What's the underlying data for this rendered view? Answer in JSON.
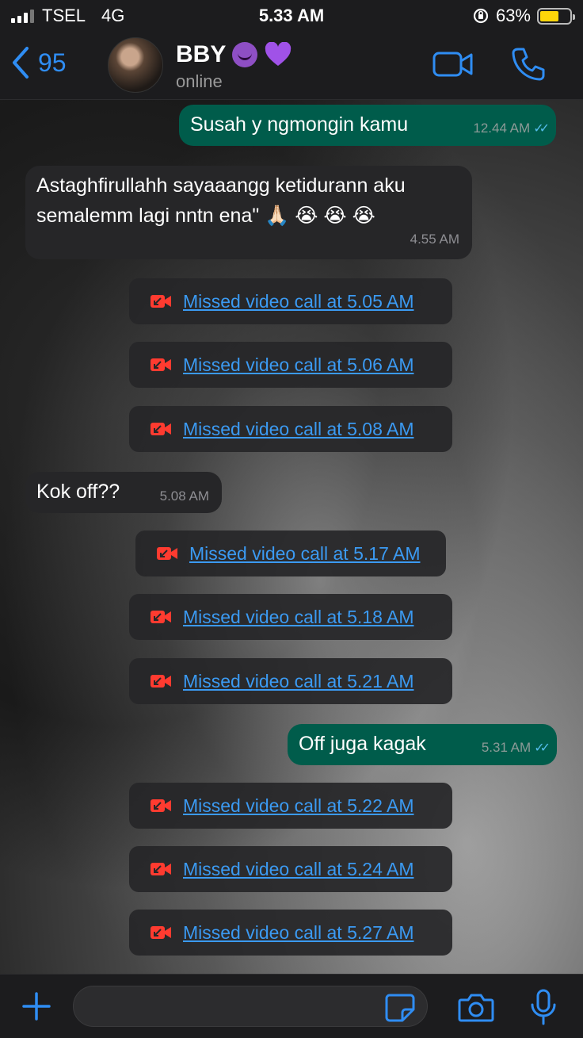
{
  "status_bar": {
    "carrier": "TSEL",
    "network": "4G",
    "time": "5.33 AM",
    "battery": "63%"
  },
  "header": {
    "back_count": "95",
    "contact_name": "BBY",
    "contact_status": "online",
    "icons": [
      "chevron-left-icon",
      "avatar",
      "devil-emoji",
      "purple-heart-emoji",
      "video-camera-icon",
      "phone-icon"
    ]
  },
  "messages": [
    {
      "type": "out",
      "text": "Susah y ngmongin kamu",
      "time": "12.44 AM"
    },
    {
      "type": "in",
      "line1": "Astaghfirullahh sayaaangg ketidurann aku",
      "line2": "semalemm lagi nntn ena\" 🙏🏻 😭 😭 😭",
      "time": "4.55 AM"
    },
    {
      "type": "missed",
      "text": "Missed video call at 5.05 AM"
    },
    {
      "type": "missed",
      "text": "Missed video call at 5.06 AM"
    },
    {
      "type": "missed",
      "text": "Missed video call at 5.08 AM"
    },
    {
      "type": "in",
      "text": "Kok off??",
      "time": "5.08 AM"
    },
    {
      "type": "missed",
      "text": "Missed video call at 5.17 AM"
    },
    {
      "type": "missed",
      "text": "Missed video call at 5.18 AM"
    },
    {
      "type": "missed",
      "text": "Missed video call at 5.21 AM"
    },
    {
      "type": "out",
      "text": "Off juga kagak",
      "time": "5.31 AM"
    },
    {
      "type": "missed",
      "text": "Missed video call at 5.22 AM"
    },
    {
      "type": "missed",
      "text": "Missed video call at 5.24 AM"
    },
    {
      "type": "missed",
      "text": "Missed video call at 5.27 AM"
    }
  ],
  "colors": {
    "accent": "#2f8df3",
    "outgoing_bubble": "#005c4b",
    "incoming_bubble": "#262628",
    "missed_call_icon": "#ff3b30",
    "read_ticks": "#53bdeb",
    "battery_fill": "#ffd60a"
  }
}
